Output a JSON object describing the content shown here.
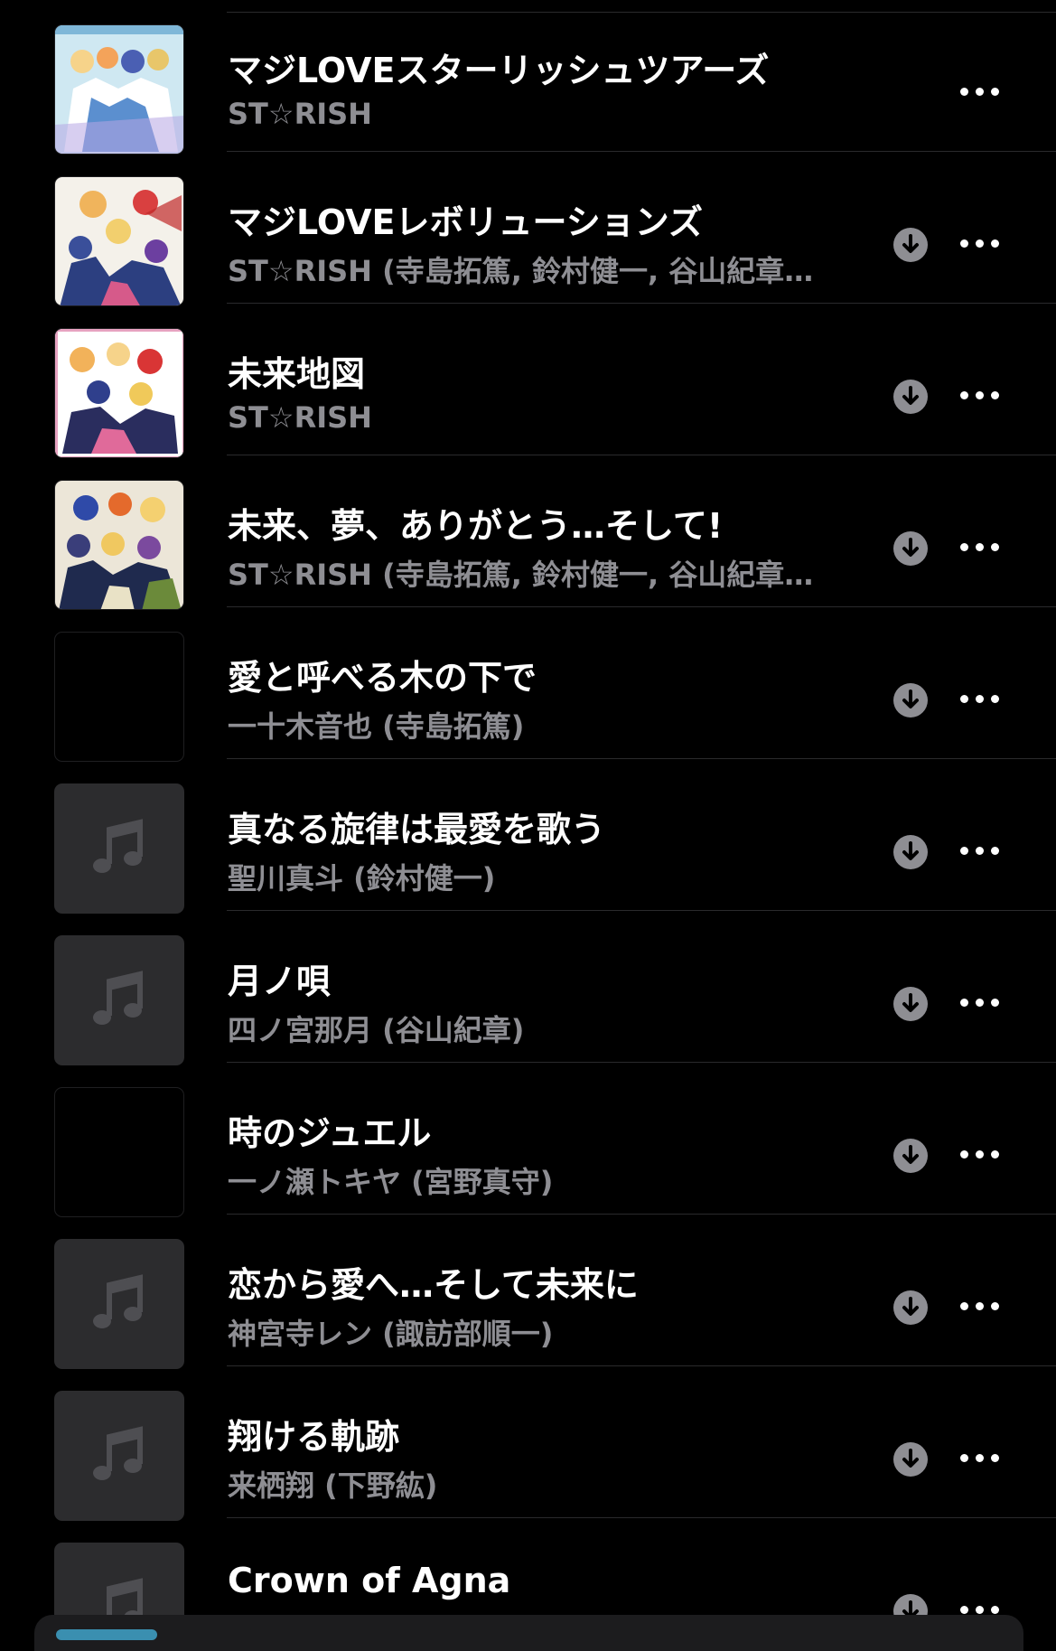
{
  "songs": [
    {
      "title": "マジLOVEスターリッシュツアーズ",
      "artist": "ST☆RISH",
      "art": "starish-tour",
      "download": false
    },
    {
      "title": "マジLOVEレボリューションズ",
      "artist": "ST☆RISH (寺島拓篤, 鈴村健一, 谷山紀章…",
      "art": "revolutions",
      "download": true
    },
    {
      "title": "未来地図",
      "artist": "ST☆RISH",
      "art": "mirai-chizu",
      "download": true
    },
    {
      "title": "未来、夢、ありがとう…そして!",
      "artist": "ST☆RISH (寺島拓篤, 鈴村健一, 谷山紀章…",
      "art": "mirai-yume",
      "download": true
    },
    {
      "title": "愛と呼べる木の下で",
      "artist": "一十木音也 (寺島拓篤)",
      "art": "blank",
      "download": true
    },
    {
      "title": "真なる旋律は最愛を歌う",
      "artist": "聖川真斗 (鈴村健一)",
      "art": "music-note",
      "download": true
    },
    {
      "title": "月ノ唄",
      "artist": "四ノ宮那月 (谷山紀章)",
      "art": "music-note",
      "download": true
    },
    {
      "title": "時のジュエル",
      "artist": "一ノ瀬トキヤ (宮野真守)",
      "art": "blank",
      "download": true
    },
    {
      "title": "恋から愛へ…そして未来に",
      "artist": "神宮寺レン (諏訪部順一)",
      "art": "music-note",
      "download": true
    },
    {
      "title": "翔ける軌跡",
      "artist": "来栖翔 (下野紘)",
      "art": "music-note",
      "download": true
    },
    {
      "title": "Crown of Agna",
      "artist": "",
      "art": "music-note",
      "download": true
    }
  ],
  "icons": {
    "download": "download-circle-icon",
    "more": "more-ellipsis-icon",
    "placeholder": "music-note-icon"
  },
  "colors": {
    "background": "#000000",
    "title": "#ffffff",
    "subtitle": "#8e8e93",
    "separator": "#2a2a2c",
    "download": "#8e8e93"
  }
}
